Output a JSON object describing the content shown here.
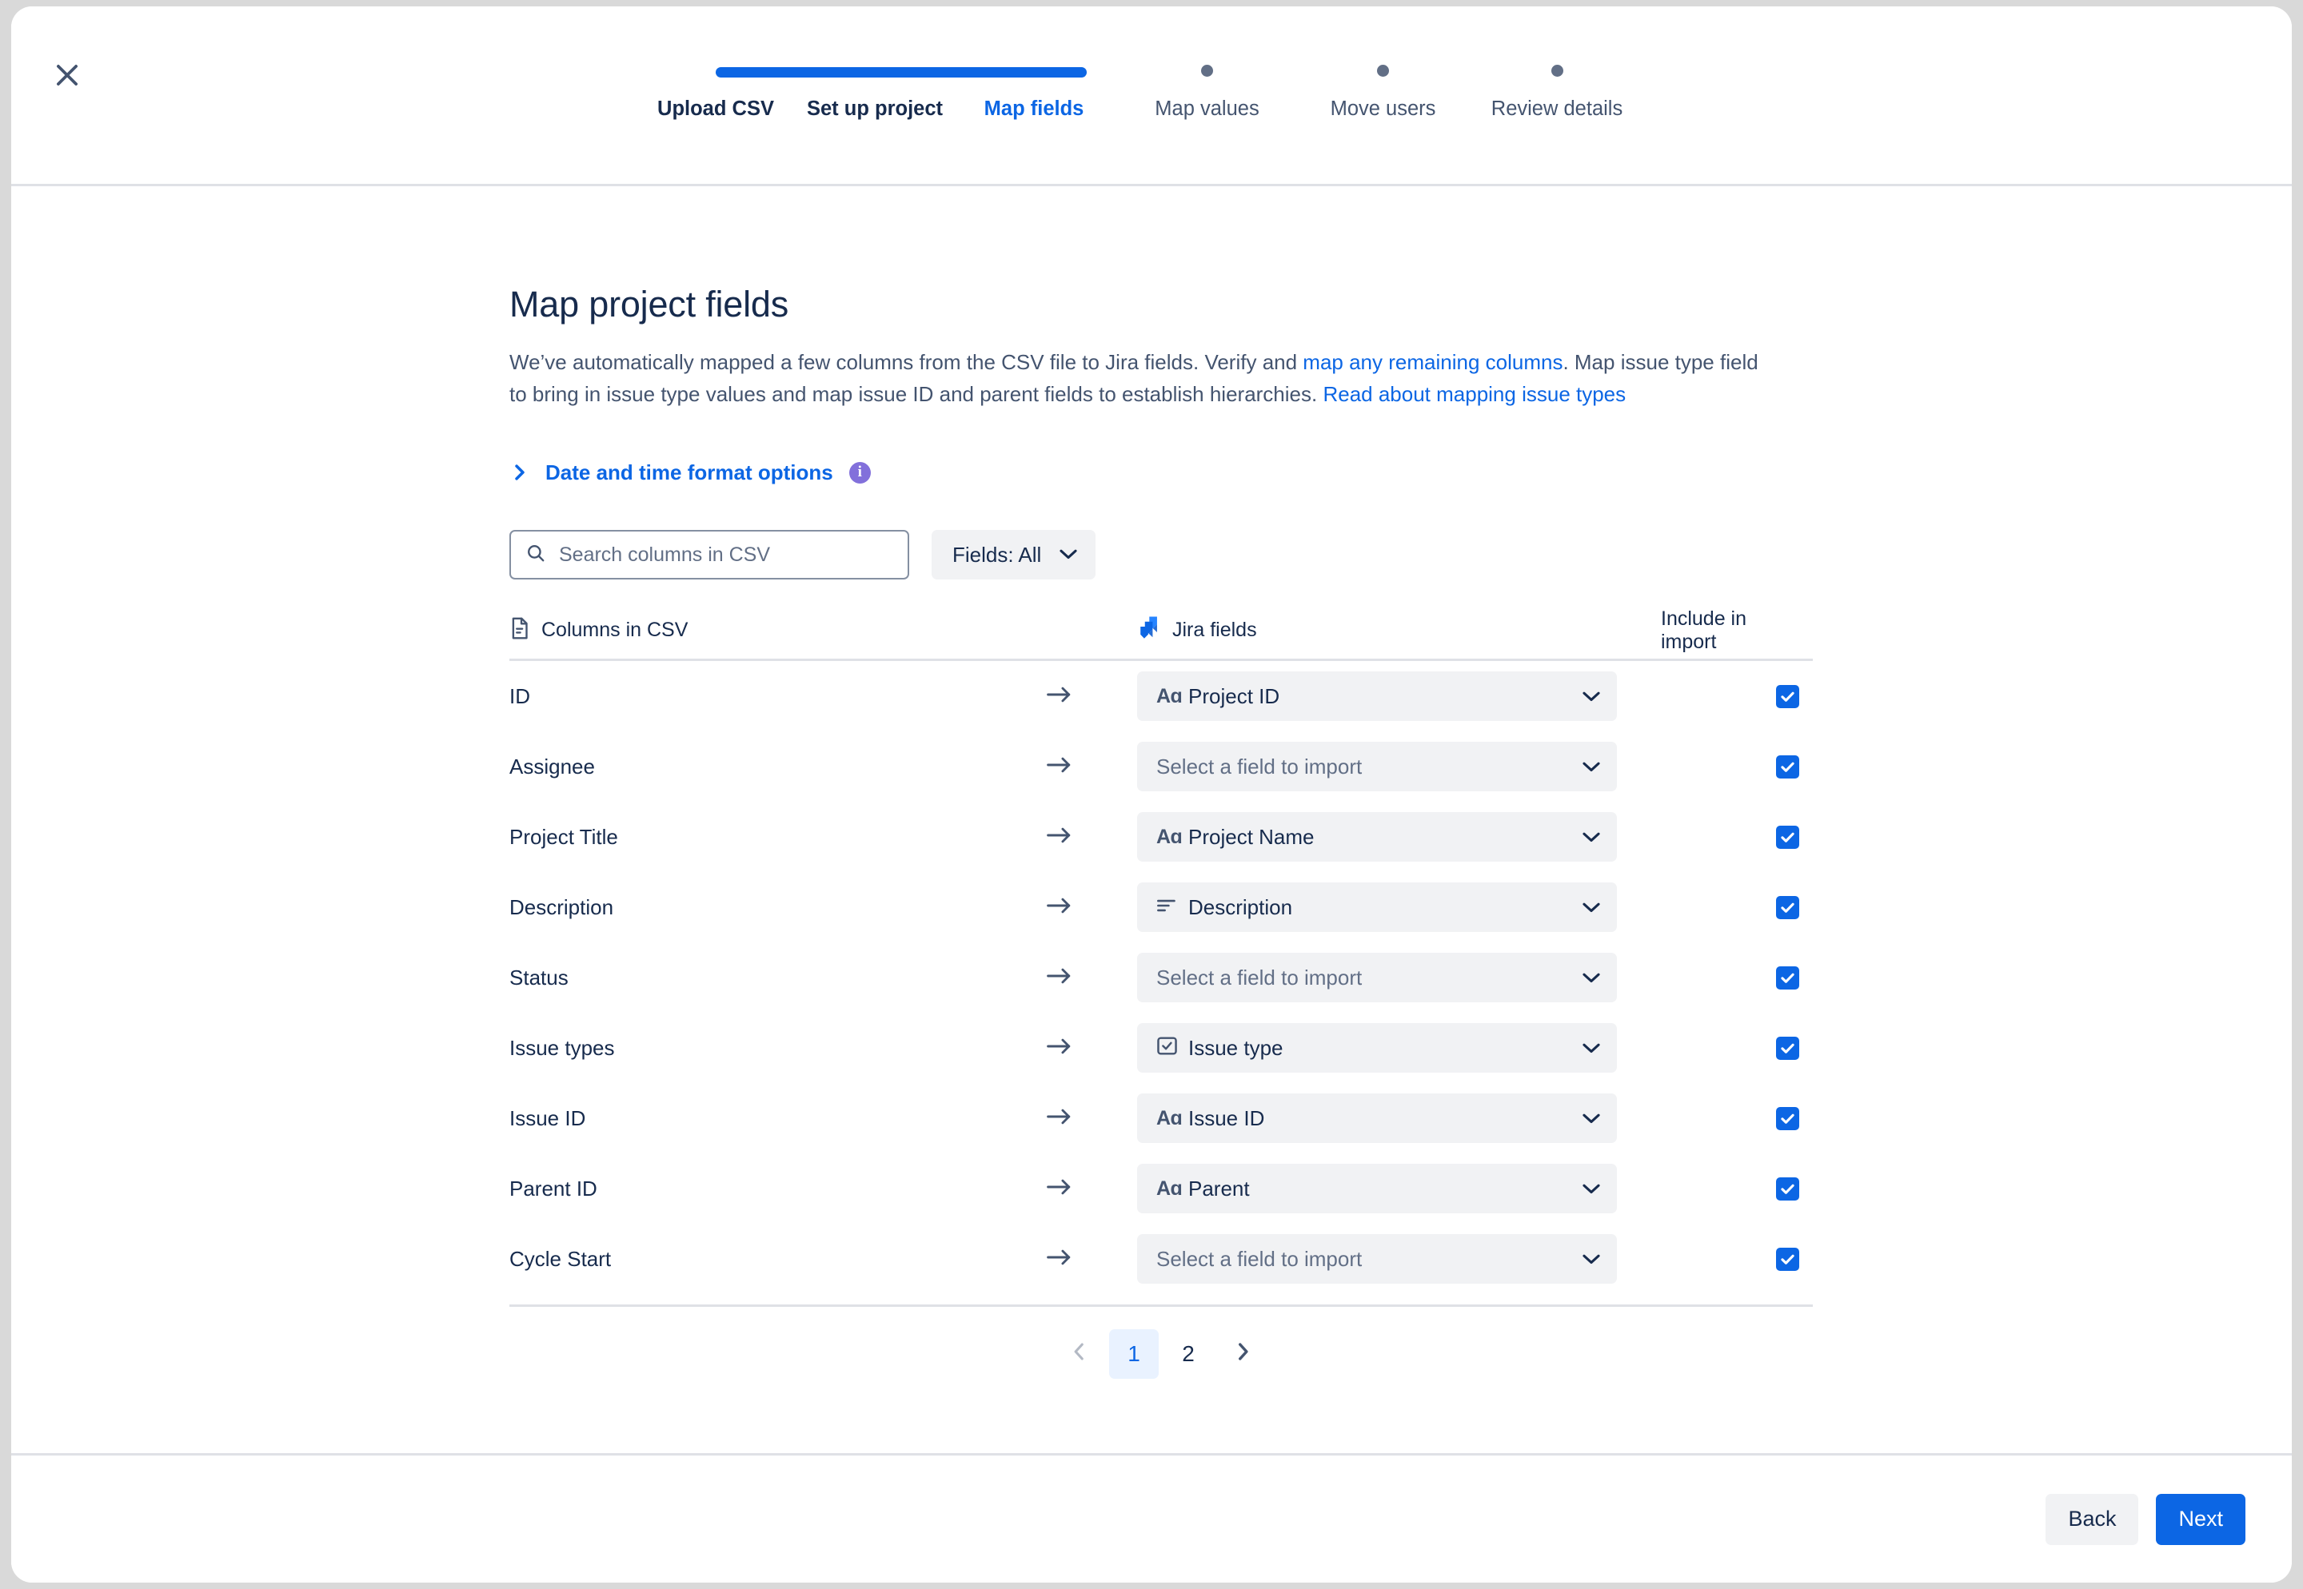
{
  "window": {
    "close_label": "Close"
  },
  "stepper": {
    "steps": [
      {
        "label": "Upload CSV",
        "state": "done"
      },
      {
        "label": "Set up project",
        "state": "done"
      },
      {
        "label": "Map fields",
        "state": "current"
      },
      {
        "label": "Map values",
        "state": "todo"
      },
      {
        "label": "Move users",
        "state": "todo"
      },
      {
        "label": "Review details",
        "state": "todo"
      }
    ],
    "active_color": "#0c66e4",
    "inactive_color": "#626f86"
  },
  "main": {
    "title": "Map project fields",
    "description": {
      "p1": "We’ve automatically mapped a few columns from the CSV file to Jira fields. Verify and ",
      "link1": "map any remaining columns",
      "p2": ". Map issue type field to bring in issue type values and map issue ID and parent fields to establish hierarchies. ",
      "link2": "Read about mapping issue types"
    },
    "date_format_options": {
      "label": "Date and time format options",
      "info_glyph": "i",
      "expanded": false
    },
    "search": {
      "placeholder": "Search columns in CSV",
      "value": ""
    },
    "fields_filter": {
      "label": "Fields: All"
    }
  },
  "table": {
    "headers": {
      "csv": "Columns in CSV",
      "jira": "Jira fields",
      "include": "Include in import"
    },
    "placeholder_option": "Select a field to import",
    "rows": [
      {
        "csv": "ID",
        "jira": "Project ID",
        "icon": "text-field-icon",
        "mapped": true,
        "include": true
      },
      {
        "csv": "Assignee",
        "jira": "",
        "icon": "",
        "mapped": false,
        "include": true
      },
      {
        "csv": "Project Title",
        "jira": "Project Name",
        "icon": "text-field-icon",
        "mapped": true,
        "include": true
      },
      {
        "csv": "Description",
        "jira": "Description",
        "icon": "paragraph-icon",
        "mapped": true,
        "include": true
      },
      {
        "csv": "Status",
        "jira": "",
        "icon": "",
        "mapped": false,
        "include": true
      },
      {
        "csv": "Issue types",
        "jira": "Issue type",
        "icon": "checkbox-sq-icon",
        "mapped": true,
        "include": true
      },
      {
        "csv": "Issue ID",
        "jira": "Issue ID",
        "icon": "text-field-icon",
        "mapped": true,
        "include": true
      },
      {
        "csv": "Parent ID",
        "jira": "Parent",
        "icon": "text-field-icon",
        "mapped": true,
        "include": true
      },
      {
        "csv": "Cycle Start",
        "jira": "",
        "icon": "",
        "mapped": false,
        "include": true
      }
    ]
  },
  "pagination": {
    "prev": "‹",
    "next": "›",
    "pages": [
      "1",
      "2"
    ],
    "current": "1"
  },
  "footer": {
    "back_label": "Back",
    "next_label": "Next"
  },
  "colors": {
    "accent": "#0c66e4",
    "text": "#172b4d",
    "subtle_text": "#44546f",
    "field_bg": "#f1f2f4",
    "border": "#dfe1e6",
    "info_purple": "#8270db"
  }
}
